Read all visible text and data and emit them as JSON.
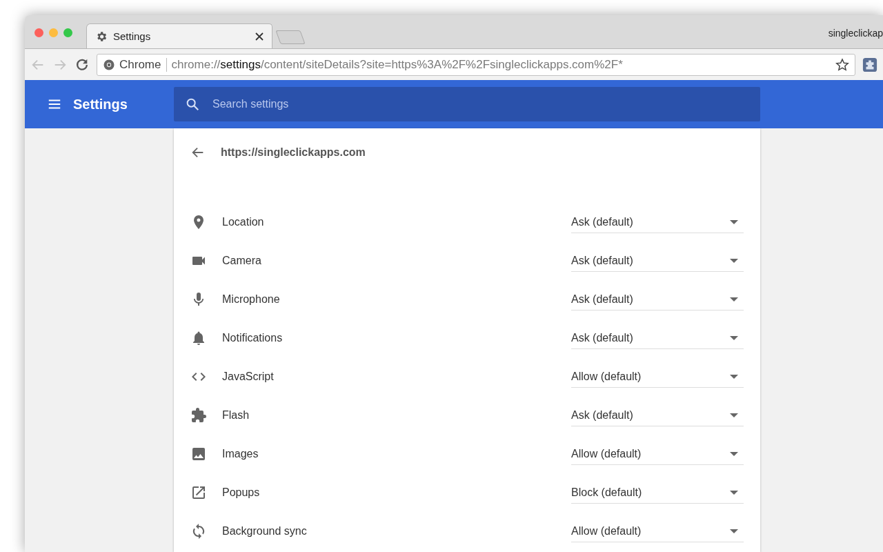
{
  "browser": {
    "tabs": [
      {
        "title": "Settings",
        "selected": true
      }
    ],
    "profile_name": "singleclickap",
    "address_bar": {
      "chip": "Chrome",
      "url_scheme": "chrome://",
      "url_host": "settings",
      "url_path": "/content/siteDetails?site=https%3A%2F%2Fsingleclickapps.com%2F*"
    }
  },
  "header": {
    "title": "Settings",
    "search": {
      "placeholder": "Search settings"
    }
  },
  "site": {
    "origin": "https://singleclickapps.com"
  },
  "permissions": [
    {
      "kind": "location",
      "label": "Location",
      "value": "Ask (default)"
    },
    {
      "kind": "camera",
      "label": "Camera",
      "value": "Ask (default)"
    },
    {
      "kind": "microphone",
      "label": "Microphone",
      "value": "Ask (default)"
    },
    {
      "kind": "notifications",
      "label": "Notifications",
      "value": "Ask (default)"
    },
    {
      "kind": "javascript",
      "label": "JavaScript",
      "value": "Allow (default)"
    },
    {
      "kind": "flash",
      "label": "Flash",
      "value": "Ask (default)"
    },
    {
      "kind": "images",
      "label": "Images",
      "value": "Allow (default)"
    },
    {
      "kind": "popups",
      "label": "Popups",
      "value": "Block (default)"
    },
    {
      "kind": "background-sync",
      "label": "Background sync",
      "value": "Allow (default)"
    }
  ]
}
